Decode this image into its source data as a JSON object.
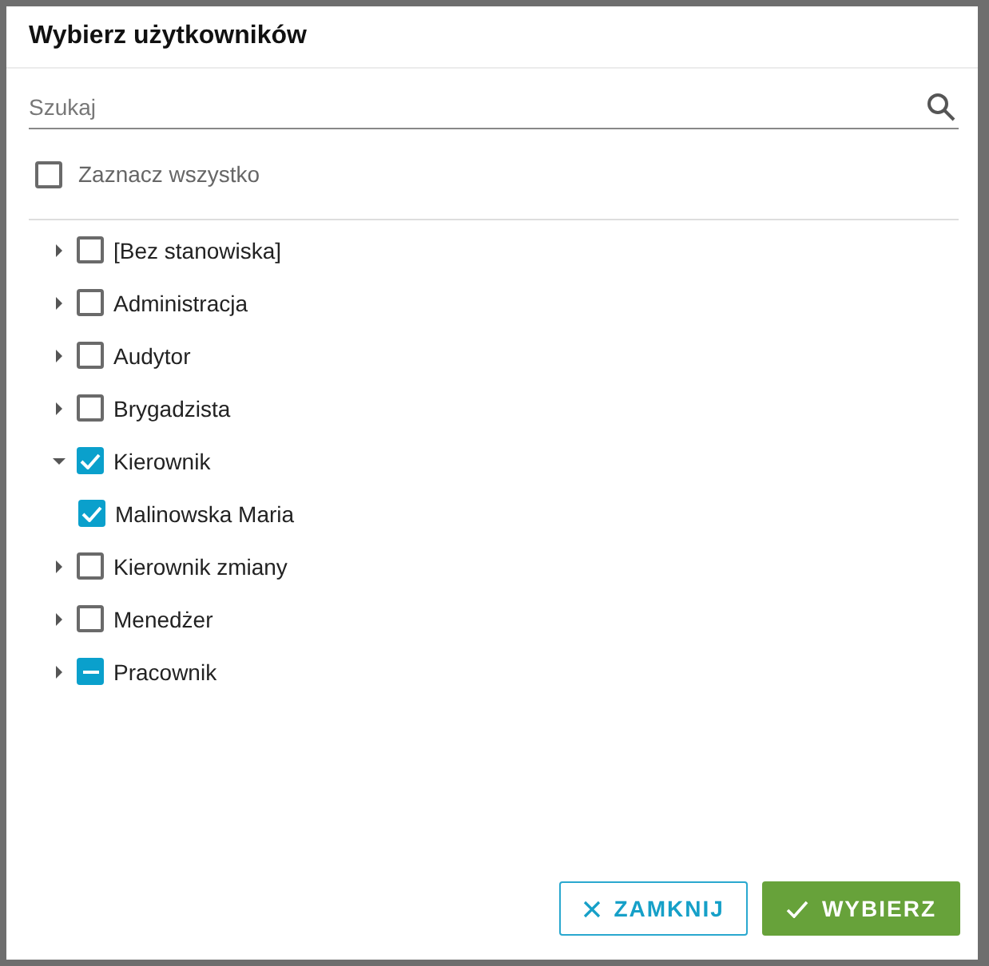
{
  "dialog": {
    "title": "Wybierz użytkowników"
  },
  "search": {
    "placeholder": "Szukaj"
  },
  "select_all": {
    "label": "Zaznacz wszystko",
    "checked": false
  },
  "tree": [
    {
      "label": "[Bez stanowiska]",
      "expanded": false,
      "checked": false,
      "partial": false
    },
    {
      "label": "Administracja",
      "expanded": false,
      "checked": false,
      "partial": false
    },
    {
      "label": "Audytor",
      "expanded": false,
      "checked": false,
      "partial": false
    },
    {
      "label": "Brygadzista",
      "expanded": false,
      "checked": false,
      "partial": false
    },
    {
      "label": "Kierownik",
      "expanded": true,
      "checked": true,
      "partial": false,
      "children": [
        {
          "label": "Malinowska Maria",
          "checked": true,
          "partial": false
        }
      ]
    },
    {
      "label": "Kierownik zmiany",
      "expanded": false,
      "checked": false,
      "partial": false
    },
    {
      "label": "Menedżer",
      "expanded": false,
      "checked": false,
      "partial": false
    },
    {
      "label": "Pracownik",
      "expanded": false,
      "checked": false,
      "partial": true
    }
  ],
  "buttons": [
    {
      "kind": "close",
      "label": "ZAMKNIJ"
    },
    {
      "kind": "confirm",
      "label": "WYBIERZ"
    }
  ]
}
